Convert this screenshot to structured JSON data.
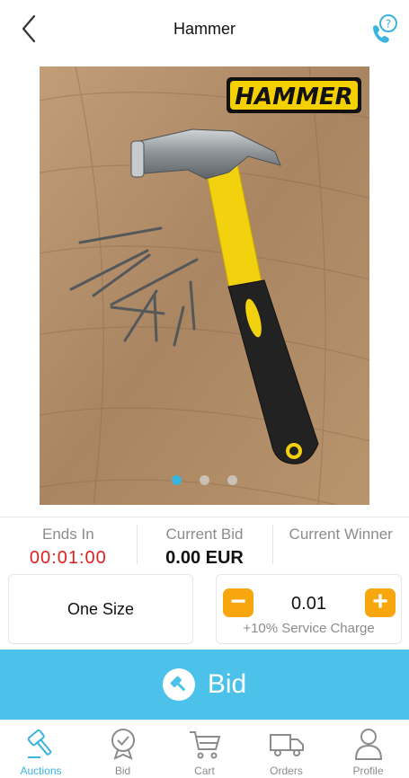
{
  "header": {
    "title": "Hammer"
  },
  "product": {
    "image_brand_text": "HAMMER",
    "carousel_pages": 3,
    "carousel_active_index": 0
  },
  "info": {
    "ends_in_label": "Ends In",
    "ends_in_value": "00:01:00",
    "current_bid_label": "Current Bid",
    "current_bid_value": "0.00 EUR",
    "current_winner_label": "Current Winner",
    "current_winner_value": ""
  },
  "options": {
    "size": "One Size",
    "minus_label": "−",
    "plus_label": "+",
    "quantity": "0.01",
    "service_charge": "+10% Service Charge"
  },
  "bid_button": {
    "label": "Bid"
  },
  "nav": {
    "items": [
      {
        "label": "Auctions",
        "icon": "gavel-icon",
        "active": true
      },
      {
        "label": "Bid",
        "icon": "check-badge-icon",
        "active": false
      },
      {
        "label": "Cart",
        "icon": "cart-icon",
        "active": false
      },
      {
        "label": "Orders",
        "icon": "truck-icon",
        "active": false
      },
      {
        "label": "Profile",
        "icon": "user-icon",
        "active": false
      }
    ]
  },
  "colors": {
    "accent": "#4cc1ea",
    "stepper": "#f7a60d",
    "countdown": "#e02020"
  }
}
